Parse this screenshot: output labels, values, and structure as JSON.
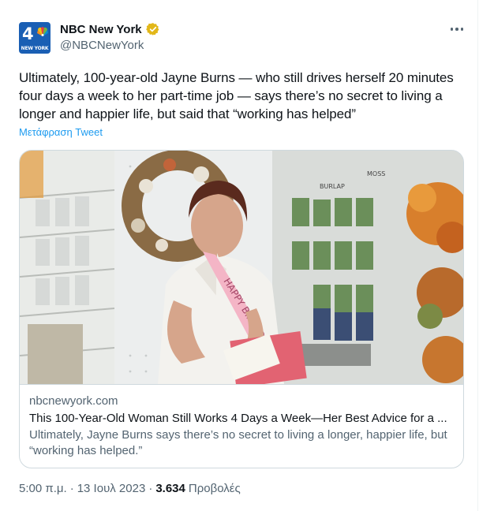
{
  "author": {
    "display_name": "NBC New York",
    "handle": "@NBCNewYork",
    "avatar_number": "4",
    "avatar_tag": "NEW YORK",
    "verified": true,
    "verified_color": "#e2b719"
  },
  "tweet": {
    "text": "Ultimately, 100-year-old Jayne Burns — who still drives herself 20 minutes four days a week to her part-time job — says there’s no secret to living a longer and happier life, but said that “working has helped”",
    "translate_label": "Μετάφραση Tweet"
  },
  "link_card": {
    "domain": "nbcnewyork.com",
    "title": "This 100-Year-Old Woman Still Works 4 Days a Week—Her Best Advice for a ...",
    "description": "Ultimately, Jayne Burns says there’s no secret to living a longer, happier life, but “working has helped.”",
    "image_icons": [
      "store-shelves",
      "wreath",
      "woman-portrait",
      "birthday-sash",
      "autumn-flowers"
    ],
    "sash_text": "HAPPY BIRTHDAY"
  },
  "footer": {
    "time": "5:00 π.μ.",
    "separator": "·",
    "date": "13 Ιουλ 2023",
    "views_count": "3.634",
    "views_label": "Προβολές"
  },
  "colors": {
    "link_blue": "#1d9bf0",
    "secondary_text": "#536471",
    "border": "#cfd9de",
    "avatar_bg": "#1a5fb4"
  }
}
